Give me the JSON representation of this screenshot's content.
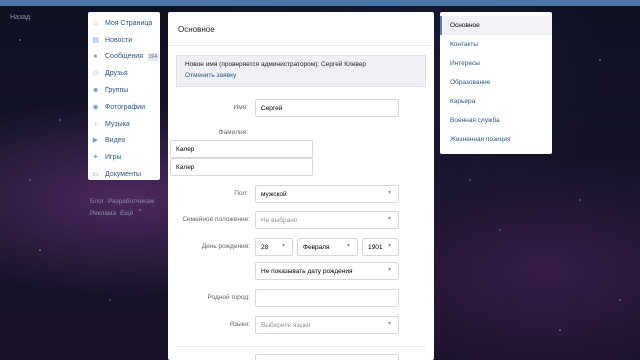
{
  "back": {
    "label": "Назад"
  },
  "leftnav": {
    "items": [
      {
        "label": "Моя Страница",
        "icon": "home-icon"
      },
      {
        "label": "Новости",
        "icon": "news-icon"
      },
      {
        "label": "Сообщения",
        "icon": "messages-icon",
        "badge": "194"
      },
      {
        "label": "Друзья",
        "icon": "friends-icon"
      },
      {
        "label": "Группы",
        "icon": "groups-icon"
      },
      {
        "label": "Фотографии",
        "icon": "photos-icon"
      },
      {
        "label": "Музыка",
        "icon": "music-icon"
      },
      {
        "label": "Видео",
        "icon": "video-icon"
      },
      {
        "label": "Игры",
        "icon": "games-icon"
      },
      {
        "label": "Документы",
        "icon": "documents-icon"
      }
    ]
  },
  "footer": {
    "links": [
      "Блог",
      "Разработчикам",
      "Реклама",
      "Ещё"
    ]
  },
  "main": {
    "title": "Основное",
    "notice": {
      "text": "Новое имя (проверяется администратором): Сергей Клевер",
      "cancel_link": "Отменить заявку"
    },
    "form": {
      "first_name": {
        "label": "Имя:",
        "value": "Сергей"
      },
      "last_name": {
        "label": "Фамилия:",
        "value_top": "Калер",
        "value_bottom": "Калер"
      },
      "sex": {
        "label": "Пол:",
        "value": "мужской"
      },
      "marital": {
        "label": "Семейное положение:",
        "value": "Не выбрано"
      },
      "birthday": {
        "label": "День рождения:",
        "day": "28",
        "month": "Февраля",
        "year": "1901",
        "visibility": "Не показывать дату рождения"
      },
      "hometown": {
        "label": "Родной город:",
        "value": ""
      },
      "languages": {
        "label": "Языки:",
        "placeholder": "Выберите языки"
      }
    }
  },
  "rightnav": {
    "items": [
      "Основное",
      "Контакты",
      "Интересы",
      "Образование",
      "Карьера",
      "Военная служба",
      "Жизненная позиция"
    ],
    "active_index": 0
  },
  "colors": {
    "accent": "#4a76a8",
    "link": "#2a5885"
  }
}
